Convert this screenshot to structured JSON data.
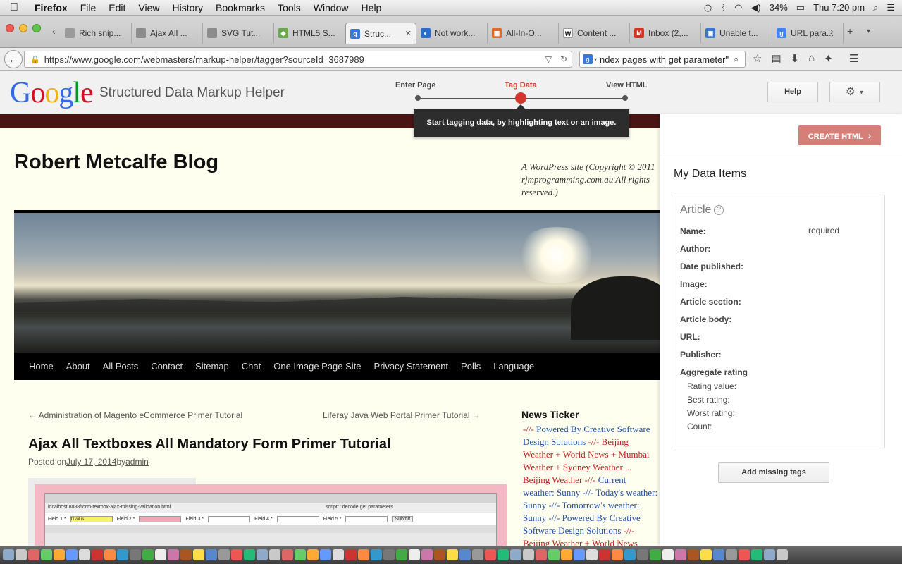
{
  "menubar": {
    "apple": "",
    "app": "Firefox",
    "items": [
      "File",
      "Edit",
      "View",
      "History",
      "Bookmarks",
      "Tools",
      "Window",
      "Help"
    ],
    "battery": "34%",
    "clock": "Thu 7:20 pm"
  },
  "tabs": [
    {
      "label": "Rich snip...",
      "color": "#9a9a9a",
      "glyph": ""
    },
    {
      "label": "Ajax All ...",
      "color": "#8c8c8c",
      "glyph": ""
    },
    {
      "label": "SVG Tut...",
      "color": "#8c8c8c",
      "glyph": ""
    },
    {
      "label": "HTML5 S...",
      "color": "#6aa84f",
      "glyph": "◆"
    },
    {
      "label": "Struc...",
      "color": "#3a77d6",
      "glyph": "g",
      "active": true
    },
    {
      "label": "Not work...",
      "color": "#2e6cc9",
      "glyph": "◐"
    },
    {
      "label": "All-In-O...",
      "color": "#e06a2a",
      "glyph": "▦"
    },
    {
      "label": "Content ...",
      "color": "#ffffff",
      "glyph": "W"
    },
    {
      "label": "Inbox (2,...",
      "color": "#d93025",
      "glyph": "M"
    },
    {
      "label": "Unable t...",
      "color": "#3a77d6",
      "glyph": "▣"
    },
    {
      "label": "URL para...",
      "color": "#4285f4",
      "glyph": "g"
    }
  ],
  "navbar": {
    "url": "https://www.google.com/webmasters/markup-helper/tagger?sourceId=3687989",
    "search_value": "ndex pages with get parameter\""
  },
  "header": {
    "logo": [
      "G",
      "o",
      "o",
      "g",
      "l",
      "e"
    ],
    "title": "Structured Data Markup Helper",
    "steps": [
      "Enter Page",
      "Tag Data",
      "View HTML"
    ],
    "help_label": "Help",
    "tooltip": "Start tagging data, by highlighting text or an image."
  },
  "page": {
    "blog_title": "Robert Metcalfe Blog",
    "blog_desc": "A WordPress site (Copyright © 2011 rjmprogramming.com.au All rights reserved.)",
    "nav": [
      "Home",
      "About",
      "All Posts",
      "Contact",
      "Sitemap",
      "Chat",
      "One Image Page Site",
      "Privacy Statement",
      "Polls",
      "Language"
    ],
    "prev_link": "← Administration of Magento eCommerce Primer Tutorial",
    "next_link": "Liferay Java Web Portal Primer Tutorial →",
    "post_title": "Ajax All Textboxes All Mandatory Form Primer Tutorial",
    "posted_on": "Posted on",
    "post_date": "July 17, 2014",
    "post_by": "by",
    "post_author": "admin",
    "screenshot": {
      "url": "localhost:8888/form-textbox-ajax-missing-validation.html",
      "search": "script\" \"decode get parameters",
      "fields": [
        "Field 1 *",
        "Field 2 *",
        "Field 3 *",
        "Field 4 *",
        "Field 5 *"
      ],
      "field1_value": "f1val is",
      "submit": "Submit"
    },
    "ticker_title": "News Ticker",
    "ticker": [
      {
        "t": "-//- ",
        "c": "r"
      },
      {
        "t": "Powered By Creative Software Design Solutions",
        "c": "b"
      },
      {
        "t": " -//- Beijing Weather + World News + Mumbai Weather + Sydney Weather ... Beijing Weather -//- ",
        "c": "r"
      },
      {
        "t": "Current weather: Sunny -//- Today's weather: Sunny -//- Tomorrow's weather: Sunny -//- Powered By Creative Software Design Solutions",
        "c": "b"
      },
      {
        "t": " -//- Beijing Weather + World News",
        "c": "r"
      }
    ]
  },
  "panel": {
    "create_label": "CREATE HTML",
    "title": "My Data Items",
    "item_type": "Article",
    "fields": [
      "Name:",
      "Author:",
      "Date published:",
      "Image:",
      "Article section:",
      "Article body:",
      "URL:",
      "Publisher:",
      "Aggregate rating"
    ],
    "subfields": [
      "Rating value:",
      "Best rating:",
      "Worst rating:",
      "Count:"
    ],
    "required_label": "required",
    "add_missing_label": "Add missing tags"
  },
  "colors": {
    "accent_red": "#d3362d",
    "create_button": "#d67f79",
    "blog_bg": "#fffff0"
  }
}
